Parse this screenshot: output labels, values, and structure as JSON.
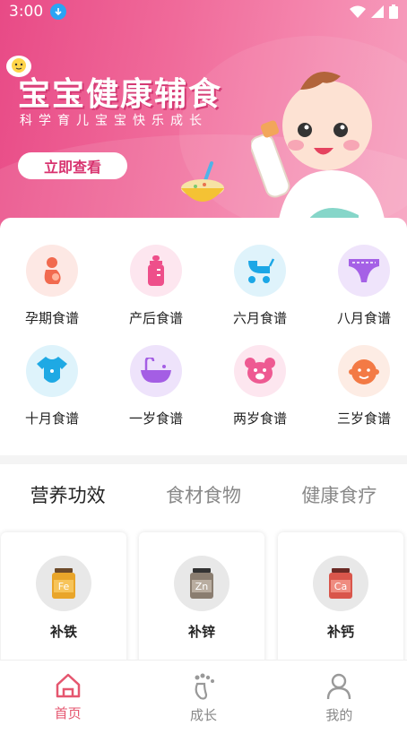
{
  "status_bar": {
    "time": "3:00"
  },
  "banner": {
    "title": "宝宝健康辅食",
    "subtitle": "科学育儿宝宝快乐成长",
    "button_label": "立即查看"
  },
  "categories": [
    {
      "label": "孕期食谱",
      "icon": "pregnant-icon",
      "bg": "#fde8e4",
      "color": "#f16a4f"
    },
    {
      "label": "产后食谱",
      "icon": "baby-bottle-icon",
      "bg": "#fde6ef",
      "color": "#ee4f8a"
    },
    {
      "label": "六月食谱",
      "icon": "stroller-icon",
      "bg": "#dff3fb",
      "color": "#1ca7e6"
    },
    {
      "label": "八月食谱",
      "icon": "diaper-icon",
      "bg": "#efe4fb",
      "color": "#a561e6"
    },
    {
      "label": "十月食谱",
      "icon": "baby-clothes-icon",
      "bg": "#def3fb",
      "color": "#1ea9e4"
    },
    {
      "label": "一岁食谱",
      "icon": "bathtub-icon",
      "bg": "#eee3fb",
      "color": "#a45ee4"
    },
    {
      "label": "两岁食谱",
      "icon": "teddy-bear-icon",
      "bg": "#fde6ef",
      "color": "#ee5a92"
    },
    {
      "label": "三岁食谱",
      "icon": "baby-face-icon",
      "bg": "#fdece4",
      "color": "#f37a45"
    }
  ],
  "tabs": [
    {
      "label": "营养功效",
      "active": true
    },
    {
      "label": "食材食物",
      "active": false
    },
    {
      "label": "健康食疗",
      "active": false
    }
  ],
  "nutrients": [
    {
      "symbol": "Fe",
      "name": "补铁",
      "color": "#e9a52a"
    },
    {
      "symbol": "Zn",
      "name": "补锌",
      "color": "#8a7d70"
    },
    {
      "symbol": "Ca",
      "name": "补钙",
      "color": "#d9564b"
    }
  ],
  "bottom_nav": [
    {
      "label": "首页",
      "icon": "home-icon",
      "active": true
    },
    {
      "label": "成长",
      "icon": "footprint-icon",
      "active": false
    },
    {
      "label": "我的",
      "icon": "user-icon",
      "active": false
    }
  ]
}
